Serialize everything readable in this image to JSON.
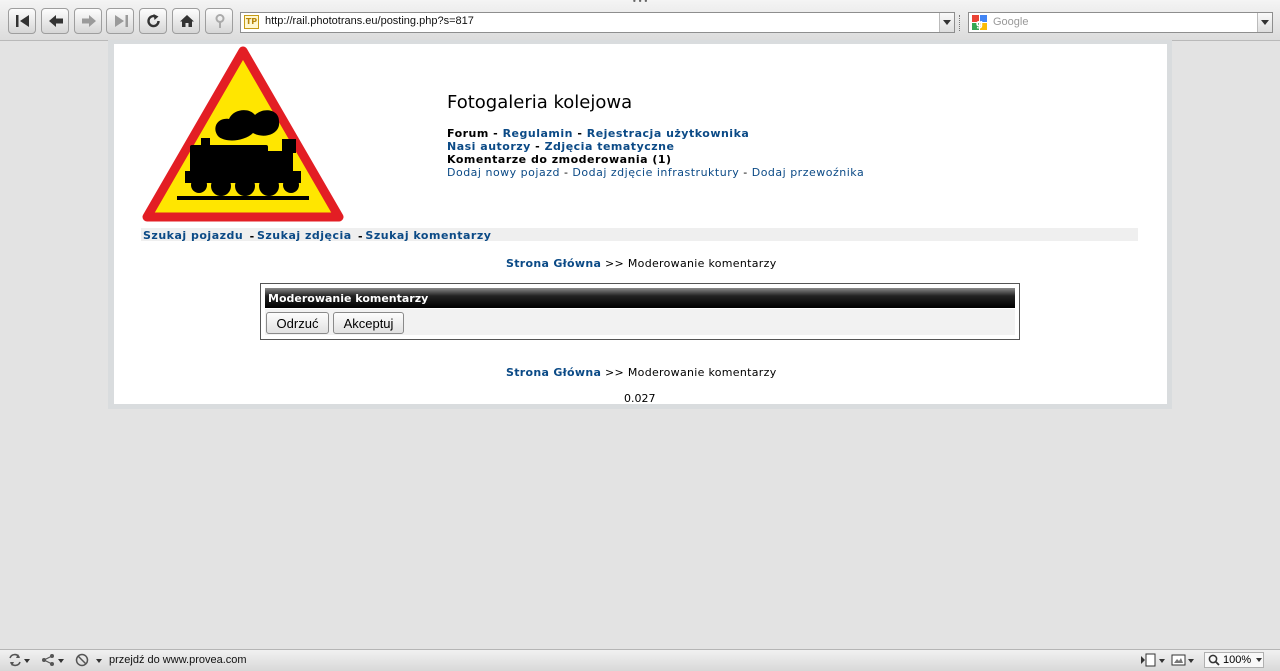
{
  "browser": {
    "url": "http://rail.phototrans.eu/posting.php?s=817",
    "site_icon_text": "TP",
    "search_engine": "Google",
    "search_placeholder": "Google",
    "status_text": "przejdź do www.provea.com",
    "zoom": "100%",
    "nav_icons": [
      "first-page-icon",
      "back-icon",
      "forward-icon",
      "last-page-icon",
      "reload-icon",
      "home-icon",
      "security-key-icon"
    ]
  },
  "site": {
    "title": "Fotogaleria kolejowa",
    "nav": {
      "forum": "Forum",
      "sep": " - ",
      "regulamin": "Regulamin",
      "rejestracja": "Rejestracja użytkownika",
      "nasi_autorzy": "Nasi autorzy",
      "zdjecia_tematyczne": "Zdjęcia tematyczne",
      "komentarze": "Komentarze do zmoderowania (1)",
      "dodaj_pojazd": "Dodaj nowy pojazd",
      "dodaj_infra": "Dodaj zdjęcie infrastruktury",
      "dodaj_przewoznika": "Dodaj przewoźnika"
    },
    "search_links": {
      "pojazd": "Szukaj pojazdu",
      "zdjecia": "Szukaj zdjęcia",
      "komentarzy": "Szukaj komentarzy"
    },
    "breadcrumb": {
      "home": "Strona Główna",
      "sep": " >> ",
      "current": "Moderowanie komentarzy"
    },
    "moderation": {
      "header": "Moderowanie komentarzy",
      "reject": "Odrzuć",
      "accept": "Akceptuj"
    },
    "generation_time": "0.027"
  }
}
